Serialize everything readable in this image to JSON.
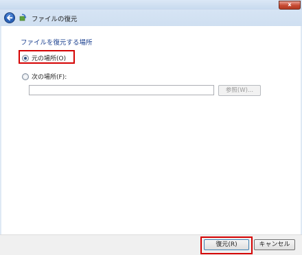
{
  "window": {
    "close_label": "x",
    "colors": {
      "highlight": "#d40000",
      "instruction_text": "#1a3f8f"
    }
  },
  "header": {
    "title": "ファイルの復元",
    "back_icon": "back-arrow-icon",
    "wizard_icon": "restore-wizard-icon"
  },
  "main": {
    "instruction": "ファイルを復元する場所",
    "options": [
      {
        "label": "元の場所(O)",
        "selected": true
      },
      {
        "label": "次の場所(F):",
        "selected": false
      }
    ],
    "path_input": {
      "value": "",
      "placeholder": ""
    },
    "browse_label": "参照(W)..."
  },
  "footer": {
    "restore_label": "復元(R)",
    "cancel_label": "キャンセル"
  }
}
